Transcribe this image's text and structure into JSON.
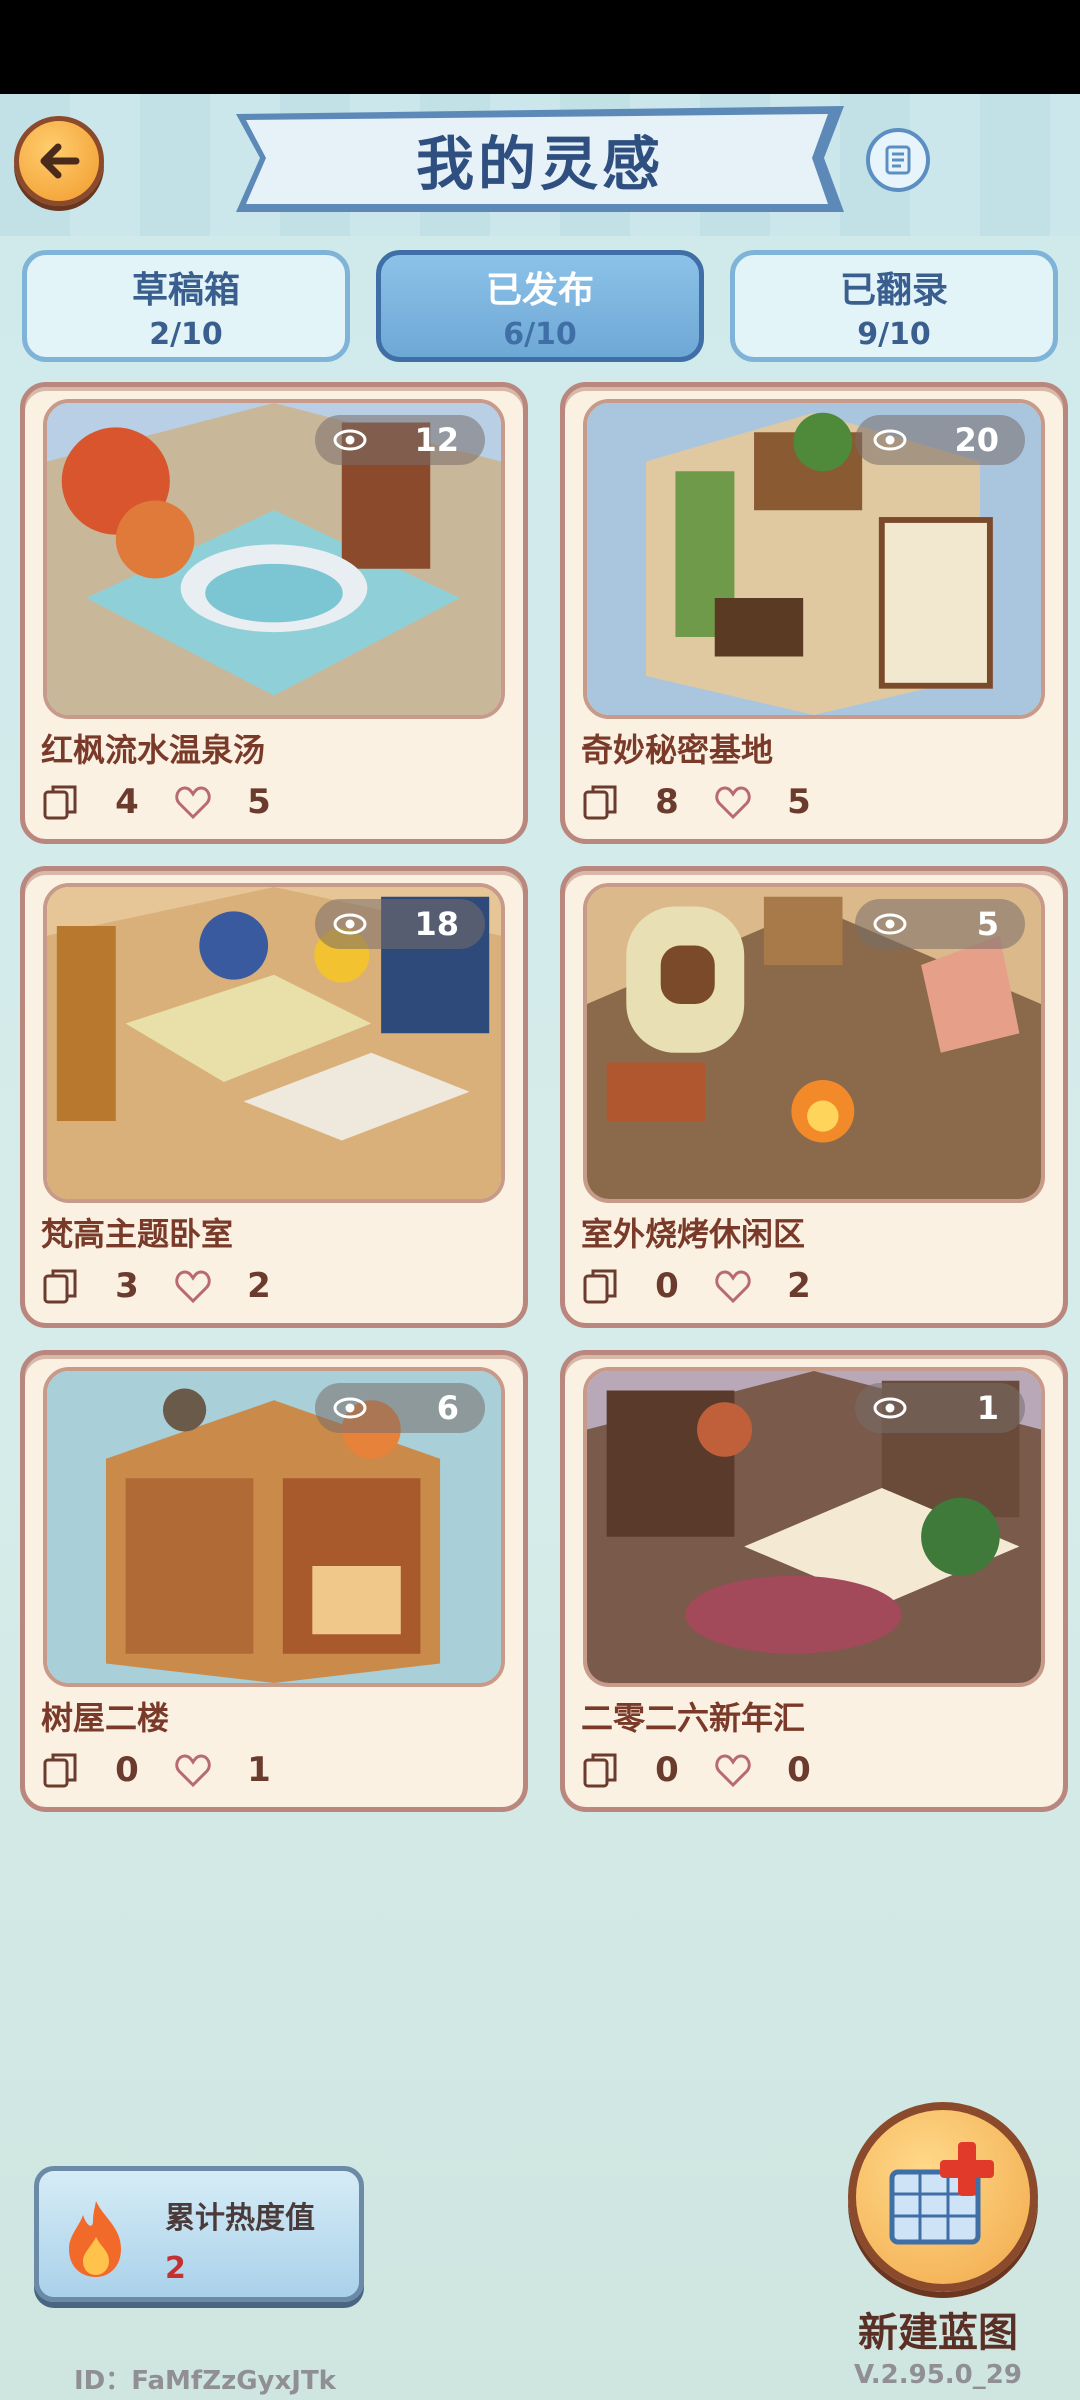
{
  "header": {
    "title": "我的灵感"
  },
  "tabs": [
    {
      "label": "草稿箱",
      "count": "2/10",
      "active": false
    },
    {
      "label": "已发布",
      "count": "6/10",
      "active": true
    },
    {
      "label": "已翻录",
      "count": "9/10",
      "active": false
    }
  ],
  "cards": [
    {
      "title": "红枫流水温泉汤",
      "views": "12",
      "copies": "4",
      "likes": "5"
    },
    {
      "title": "奇妙秘密基地",
      "views": "20",
      "copies": "8",
      "likes": "5"
    },
    {
      "title": "梵高主题卧室",
      "views": "18",
      "copies": "3",
      "likes": "2"
    },
    {
      "title": "室外烧烤休闲区",
      "views": "5",
      "copies": "0",
      "likes": "2"
    },
    {
      "title": "树屋二楼",
      "views": "6",
      "copies": "0",
      "likes": "1"
    },
    {
      "title": "二零二六新年汇",
      "views": "1",
      "copies": "0",
      "likes": "0"
    }
  ],
  "heat": {
    "label": "累计热度值",
    "value": "2"
  },
  "new_blueprint": {
    "label": "新建蓝图"
  },
  "footer": {
    "user_id": "ID：FaMfZzGyxJTk",
    "version": "V.2.95.0_29"
  },
  "colors": {
    "title": "#2f4f80",
    "card_border": "#b9877d",
    "card_bg": "#fbf1e2",
    "heat_value": "#c43131",
    "accent_orange": "#f19a2c"
  },
  "icons": [
    "back-arrow-icon",
    "scroll-icon",
    "eye-icon",
    "copy-icon",
    "heart-icon",
    "flame-icon",
    "blueprint-plus-icon"
  ]
}
